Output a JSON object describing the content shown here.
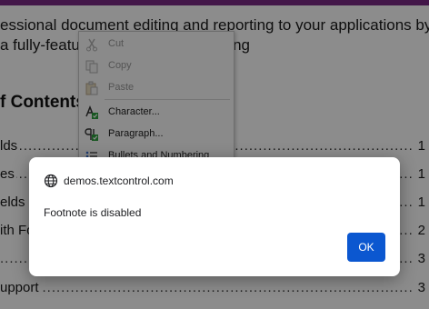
{
  "document": {
    "line1": "essional document editing and reporting to your applications by",
    "line2": "a fully-featu                            ntuitive word processing",
    "toc_title": "f Contents",
    "toc_rows": [
      {
        "label": "lds",
        "page": "1"
      },
      {
        "label": "es",
        "page": "1"
      },
      {
        "label": "elds",
        "page": "1"
      },
      {
        "label": "ith Fo",
        "page": "2"
      },
      {
        "label": "",
        "page": "3"
      },
      {
        "label": "upport",
        "page": "3"
      }
    ]
  },
  "context_menu": {
    "items": [
      {
        "label": "Cut",
        "icon": "cut-icon",
        "enabled": false
      },
      {
        "label": "Copy",
        "icon": "copy-icon",
        "enabled": false
      },
      {
        "label": "Paste",
        "icon": "paste-icon",
        "enabled": false
      },
      {
        "label": "Character...",
        "icon": "character-icon",
        "enabled": true
      },
      {
        "label": "Paragraph...",
        "icon": "paragraph-icon",
        "enabled": true
      },
      {
        "label": "Bullets and Numbering",
        "icon": "bullets-icon",
        "enabled": true
      }
    ]
  },
  "dialog": {
    "origin": "demos.textcontrol.com",
    "message": "Footnote is disabled",
    "ok_label": "OK",
    "ok_color": "#0b57d0"
  },
  "colors": {
    "top_bar": "#7a2a86",
    "overlay": "rgba(0,0,0,0.45)"
  }
}
